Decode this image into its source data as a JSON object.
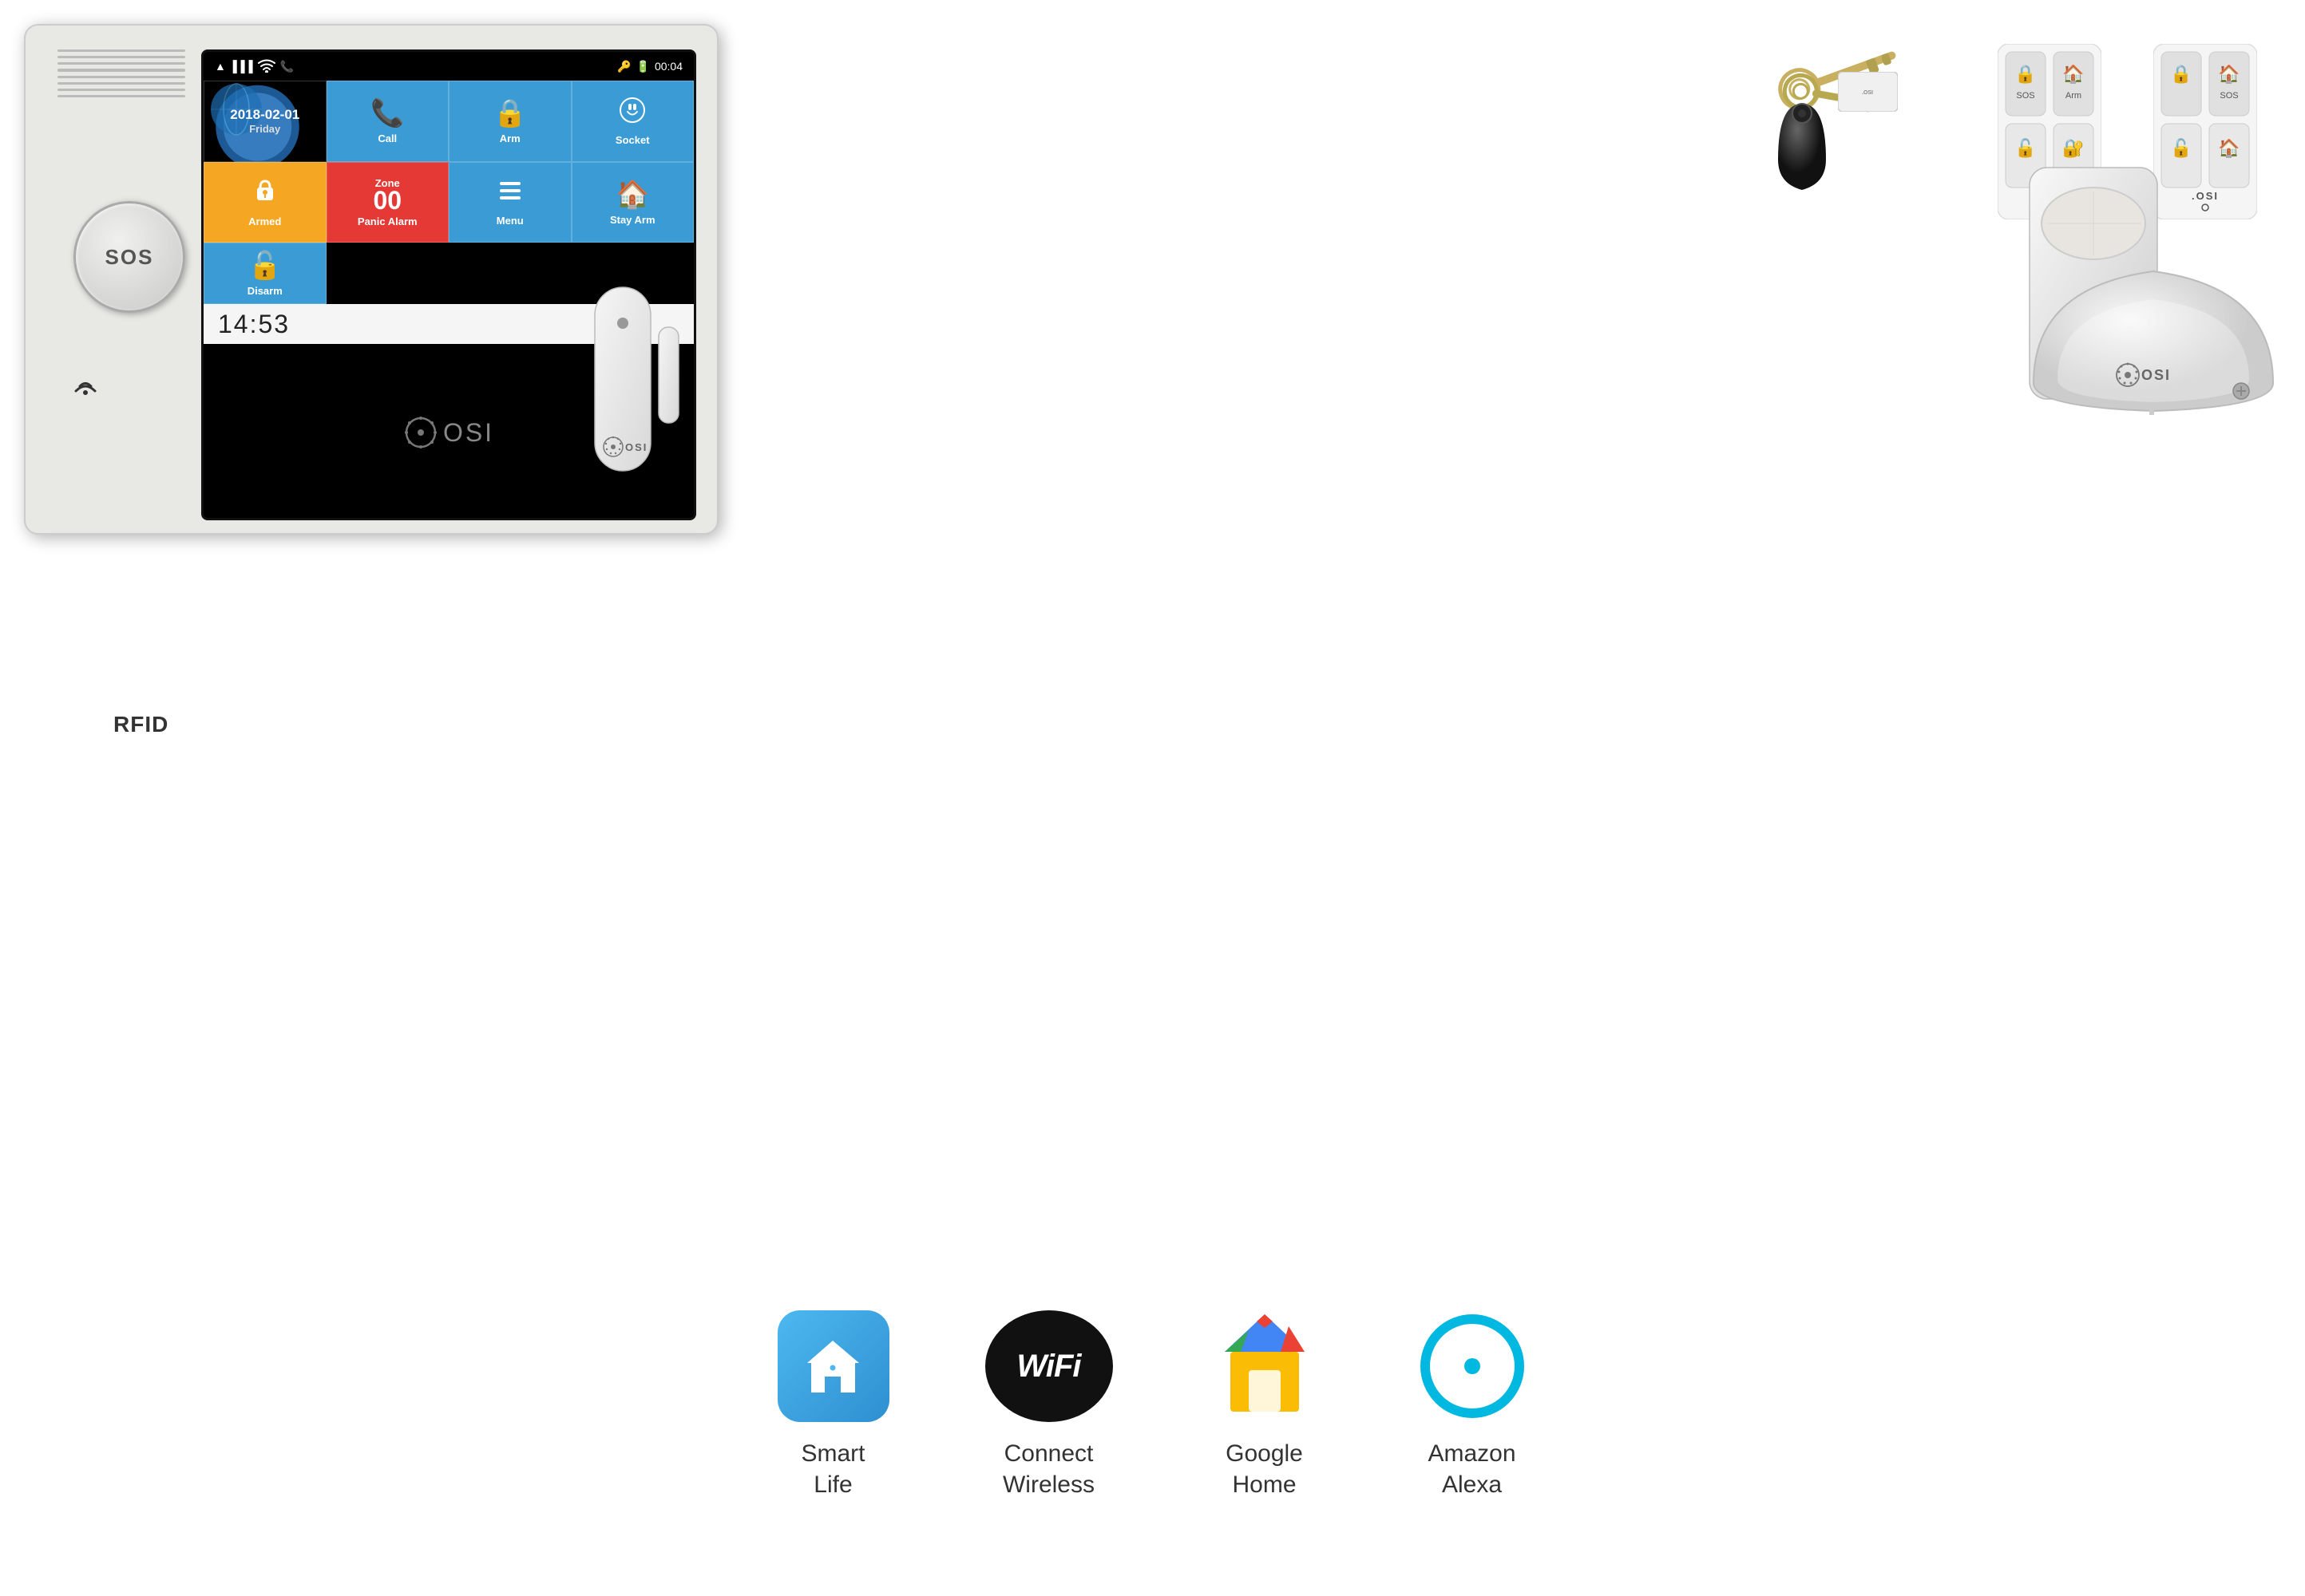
{
  "panel": {
    "sos_label": "SOS",
    "rfid_label": "RFID",
    "screen": {
      "date": "2018-02-01",
      "day": "Friday",
      "time": "14:53",
      "battery": "00:04",
      "grid_cells": [
        {
          "id": "date",
          "label": "2018-02-01",
          "sublabel": "Friday",
          "color": "blue"
        },
        {
          "id": "call",
          "label": "Call",
          "color": "blue"
        },
        {
          "id": "arm",
          "label": "Arm",
          "color": "blue"
        },
        {
          "id": "socket",
          "label": "Socket",
          "color": "blue"
        },
        {
          "id": "armed",
          "label": "Armed",
          "color": "orange"
        },
        {
          "id": "panic",
          "label": "Panic Alarm",
          "zone": "Zone 00",
          "color": "red"
        },
        {
          "id": "menu",
          "label": "Menu",
          "color": "blue"
        },
        {
          "id": "stay-arm",
          "label": "Stay Arm",
          "color": "blue"
        },
        {
          "id": "disarm",
          "label": "Disarm",
          "color": "blue"
        }
      ],
      "osi_brand": ".OSI"
    }
  },
  "accessories": {
    "pir_brand": ".OSI",
    "door_sensor_brand": ".OSI",
    "siren_brand": ".OSI",
    "remote_brand": ".OSI"
  },
  "features": [
    {
      "id": "smart-life",
      "icon": "house",
      "label": "Smart\nLife"
    },
    {
      "id": "connect-wireless",
      "icon": "wifi",
      "label": "Connect\nWireless"
    },
    {
      "id": "google-home",
      "icon": "google-home",
      "label": "Google\nHome"
    },
    {
      "id": "amazon-alexa",
      "icon": "alexa",
      "label": "Amazon\nAlexa"
    }
  ],
  "labels": {
    "smart_life": "Smart\nLife",
    "connect_wireless": "Connect\nWireless",
    "google_home": "Google\nHome",
    "amazon_alexa": "Amazon\nAlexa"
  }
}
